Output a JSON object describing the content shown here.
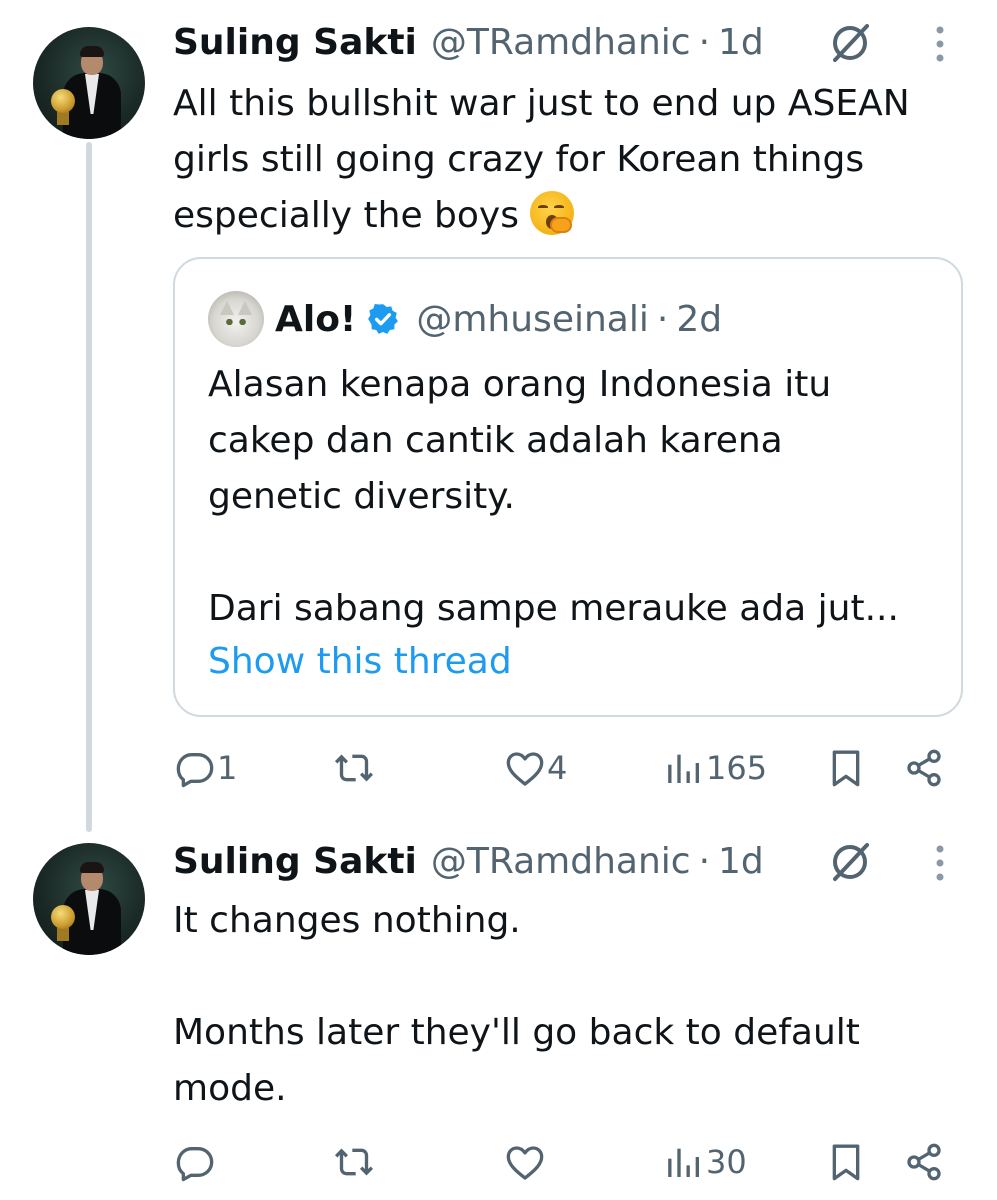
{
  "tweets": [
    {
      "name": "Suling Sakti",
      "handle": "@TRamdhanic",
      "separator": "·",
      "time": "1d",
      "text": "All this bullshit war just to end up ASEAN\ngirls still going crazy for Korean things\nespecially the boys ",
      "emoji": "yawning-face",
      "quote": {
        "name": "Alo!",
        "verified": true,
        "handle": "@mhuseinali",
        "separator": "·",
        "time": "2d",
        "text": "Alasan kenapa orang Indonesia itu\ncakep dan cantik adalah karena\ngenetic diversity.\n\nDari sabang sampe merauke ada jut...",
        "link": "Show this thread"
      },
      "actions": {
        "replies": "1",
        "reposts": "",
        "likes": "4",
        "views": "165"
      }
    },
    {
      "name": "Suling Sakti",
      "handle": "@TRamdhanic",
      "separator": "·",
      "time": "1d",
      "text": "It changes nothing.\n\nMonths later they'll go back to default\nmode.",
      "actions": {
        "replies": "",
        "reposts": "",
        "likes": "",
        "views": "30"
      }
    }
  ],
  "colors": {
    "text": "#0f1419",
    "secondary": "#536471",
    "link": "#1d9bf0",
    "border": "#cfd9de",
    "verified": "#1d9bf0"
  },
  "icons": [
    "grok-icon",
    "more-icon",
    "reply-icon",
    "repost-icon",
    "like-icon",
    "views-icon",
    "bookmark-icon",
    "share-icon",
    "verified-icon"
  ]
}
